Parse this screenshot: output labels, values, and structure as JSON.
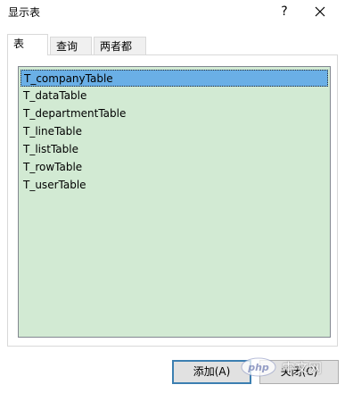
{
  "window": {
    "title": "显示表",
    "help": "?"
  },
  "tabs": [
    {
      "label": "表",
      "active": true
    },
    {
      "label": "查询",
      "active": false
    },
    {
      "label": "两者都有",
      "active": false
    }
  ],
  "list": {
    "items": [
      "T_companyTable",
      "T_dataTable",
      "T_departmentTable",
      "T_lineTable",
      "T_listTable",
      "T_rowTable",
      "T_userTable"
    ],
    "selected_index": 0
  },
  "buttons": {
    "add": "添加(A)",
    "close": "关闭(C)"
  },
  "watermark": {
    "text": "中文网",
    "logo": "php"
  },
  "colors": {
    "list_bg": "#d2ead3",
    "selected": "#6aafe6",
    "accent_border": "#3c7fb1"
  }
}
